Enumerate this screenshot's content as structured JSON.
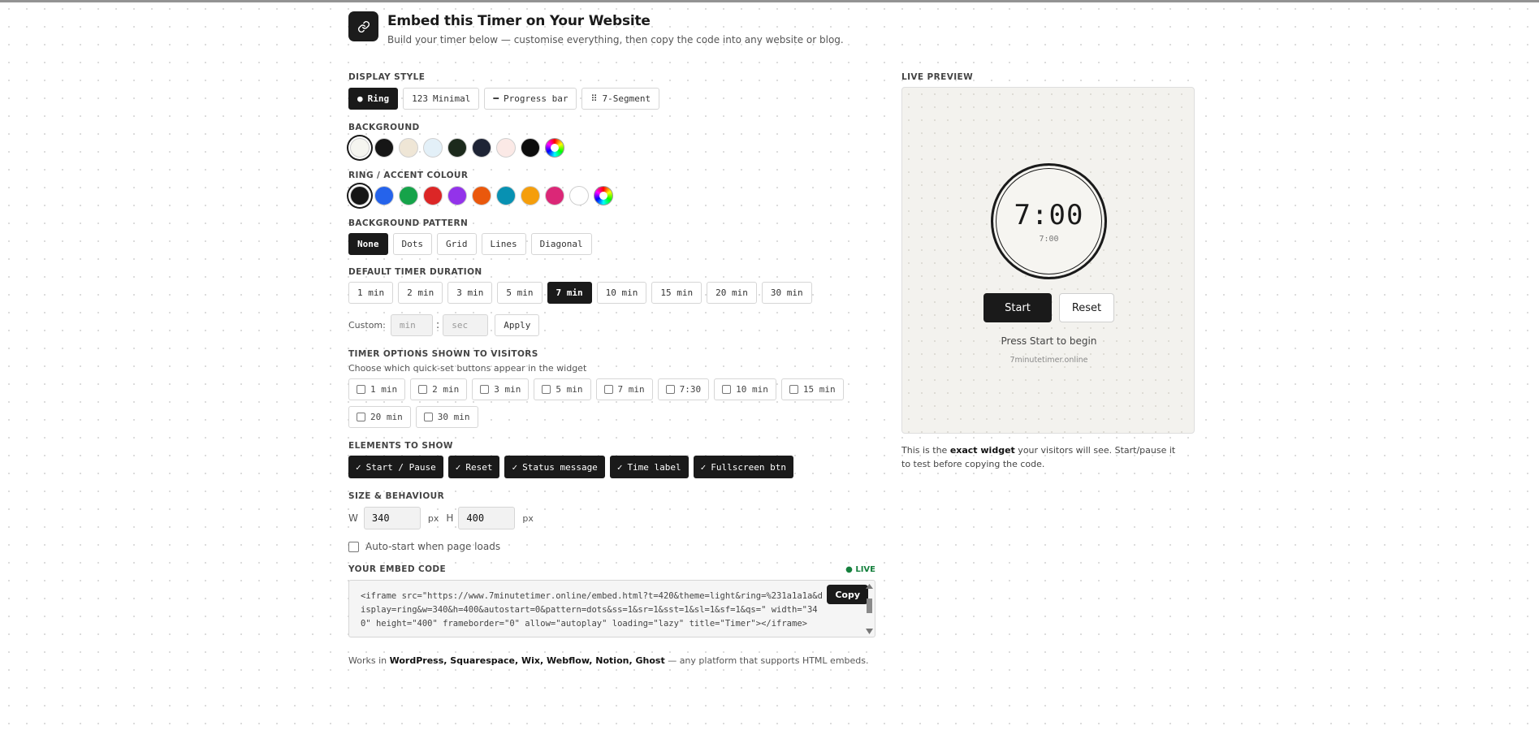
{
  "header": {
    "title": "Embed this Timer on Your Website",
    "subtitle": "Build your timer below — customise everything, then copy the code into any website or blog."
  },
  "display_style": {
    "label": "DISPLAY STYLE",
    "options": [
      {
        "icon": "●",
        "label": "Ring",
        "active": true
      },
      {
        "icon": "123",
        "label": "Minimal",
        "active": false
      },
      {
        "icon": "━",
        "label": "Progress bar",
        "active": false
      },
      {
        "icon": "⠿",
        "label": "7-Segment",
        "active": false
      }
    ]
  },
  "background": {
    "label": "BACKGROUND",
    "colors": [
      "#f5f5f0",
      "#161616",
      "#efe6d6",
      "#e3f0f8",
      "#1c2a1c",
      "#1e2435",
      "#fbe9e6",
      "#0d0d0d",
      "rainbow"
    ],
    "selected": 0
  },
  "accent": {
    "label": "RING / ACCENT COLOUR",
    "colors": [
      "#161616",
      "#2563eb",
      "#16a34a",
      "#dc2626",
      "#9333ea",
      "#ea580c",
      "#0891b2",
      "#f59e0b",
      "#db2777",
      "#ffffff",
      "rainbow"
    ],
    "selected": 0
  },
  "pattern": {
    "label": "BACKGROUND PATTERN",
    "options": [
      "None",
      "Dots",
      "Grid",
      "Lines",
      "Diagonal"
    ],
    "active": "None"
  },
  "duration": {
    "label": "DEFAULT TIMER DURATION",
    "options": [
      "1 min",
      "2 min",
      "3 min",
      "5 min",
      "7 min",
      "10 min",
      "15 min",
      "20 min",
      "30 min"
    ],
    "active": "7 min",
    "custom_label": "Custom:",
    "min_placeholder": "min",
    "sec_placeholder": "sec",
    "separator": ":",
    "apply": "Apply"
  },
  "timer_options": {
    "label": "TIMER OPTIONS SHOWN TO VISITORS",
    "hint": "Choose which quick-set buttons appear in the widget",
    "row1": [
      "1 min",
      "2 min",
      "3 min",
      "5 min",
      "7 min",
      "7:30",
      "10 min",
      "15 min"
    ],
    "row2": [
      "20 min",
      "30 min"
    ]
  },
  "elements": {
    "label": "ELEMENTS TO SHOW",
    "check": "✓",
    "items": [
      "Start / Pause",
      "Reset",
      "Status message",
      "Time label",
      "Fullscreen btn"
    ]
  },
  "size": {
    "label": "SIZE & BEHAVIOUR",
    "w_label": "W",
    "w_value": "340",
    "h_label": "H",
    "h_value": "400",
    "unit": "px",
    "autostart": "Auto-start when page loads"
  },
  "embed": {
    "label": "YOUR EMBED CODE",
    "live": "● LIVE",
    "code": "<iframe src=\"https://www.7minutetimer.online/embed.html?t=420&theme=light&ring=%231a1a1a&display=ring&w=340&h=400&autostart=0&pattern=dots&ss=1&sr=1&sst=1&sl=1&sf=1&qs=\" width=\"340\" height=\"400\" frameborder=\"0\" allow=\"autoplay\" loading=\"lazy\" title=\"Timer\"></iframe>",
    "copy": "Copy"
  },
  "footer": {
    "prefix": "Works in ",
    "platforms": "WordPress, Squarespace, Wix, Webflow, Notion, Ghost",
    "suffix": " — any platform that supports HTML embeds."
  },
  "preview": {
    "label": "LIVE PREVIEW",
    "time": "7:00",
    "time_label": "7:00",
    "start": "Start",
    "reset": "Reset",
    "status": "Press Start to begin",
    "brand": "7minutetimer.online",
    "note_prefix": "This is the ",
    "note_bold": "exact widget",
    "note_suffix": " your visitors will see. Start/pause it to test before copying the code."
  }
}
